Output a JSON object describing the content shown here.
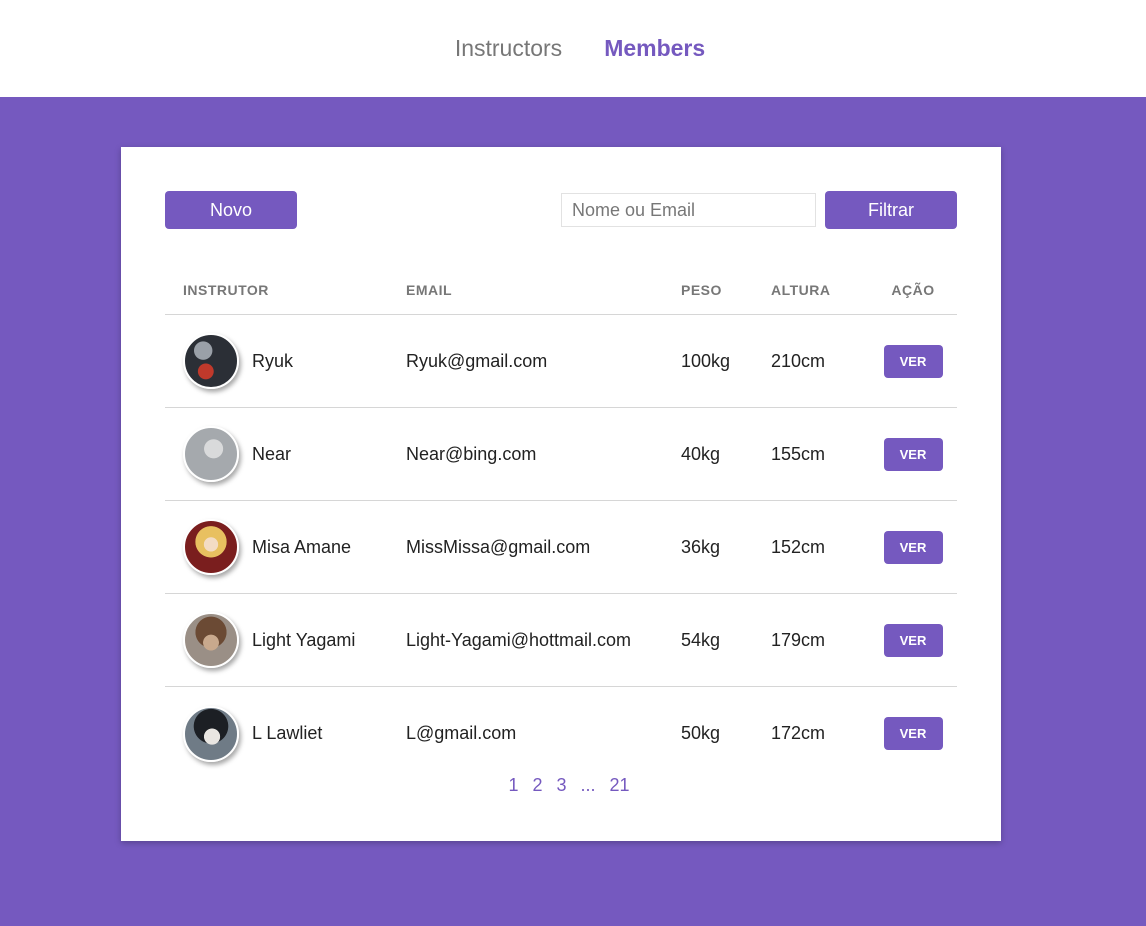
{
  "nav": {
    "instructors": "Instructors",
    "members": "Members"
  },
  "toolbar": {
    "new_label": "Novo",
    "search_placeholder": "Nome ou Email",
    "search_value": "",
    "filter_label": "Filtrar"
  },
  "table": {
    "headers": [
      "INSTRUTOR",
      "EMAIL",
      "PESO",
      "ALTURA",
      "AÇÃO"
    ],
    "rows": [
      {
        "name": "Ryuk",
        "email": "Ryuk@gmail.com",
        "weight": "100kg",
        "height": "210cm",
        "action": "VER"
      },
      {
        "name": "Near",
        "email": "Near@bing.com",
        "weight": "40kg",
        "height": "155cm",
        "action": "VER"
      },
      {
        "name": "Misa Amane",
        "email": "MissMissa@gmail.com",
        "weight": "36kg",
        "height": "152cm",
        "action": "VER"
      },
      {
        "name": "Light Yagami",
        "email": "Light-Yagami@hottmail.com",
        "weight": "54kg",
        "height": "179cm",
        "action": "VER"
      },
      {
        "name": "L Lawliet",
        "email": "L@gmail.com",
        "weight": "50kg",
        "height": "172cm",
        "action": "VER"
      }
    ]
  },
  "pagination": [
    "1",
    "2",
    "3",
    "...",
    "21"
  ],
  "colors": {
    "accent": "#7559bf",
    "background": "#7559bf",
    "card": "#ffffff"
  }
}
